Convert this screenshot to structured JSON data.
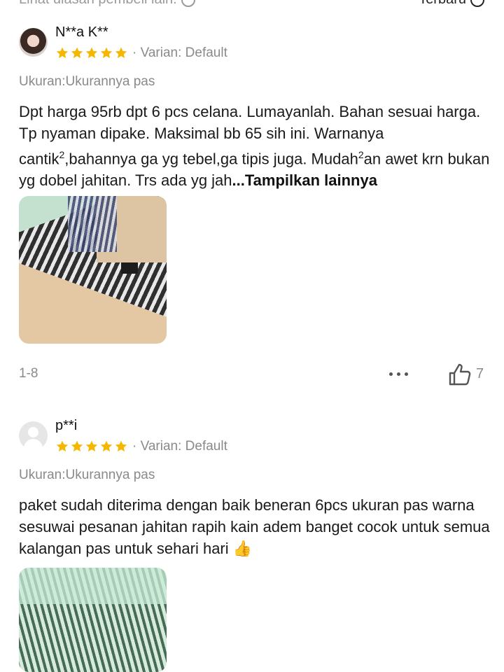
{
  "top": {
    "left_text": "Lihat ulasan pembeli lain.",
    "sort_label": "Terbaru"
  },
  "reviews": [
    {
      "username": "N**a K**",
      "rating": 5,
      "variant": "· Varian: Default",
      "size": "Ukuran:Ukurannya pas",
      "text_parts": [
        "Dpt harga 95rb dpt 6 pcs celana. Lumayanlah. Bahan sesuai harga. Tp nyaman dipake. Maksimal bb 65 sih ini. Warnanya cantik",
        "2",
        ",bahannya ga yg tebel,ga tipis juga. Mudah",
        "2",
        "an awet krn bukan yg dobel jahitan. Trs ada yg jah"
      ],
      "more_label": "...Tampilkan lainnya",
      "page_range": "1-8",
      "like_count": "7"
    },
    {
      "username": "p**i",
      "rating": 5,
      "variant": "· Varian: Default",
      "size": "Ukuran:Ukurannya pas",
      "text": "paket sudah diterima dengan baik beneran 6pcs ukuran pas warna sesuwai pesanan jahitan rapih kain adem banget cocok untuk semua kalangan pas untuk sehari hari 👍"
    }
  ],
  "colors": {
    "star": "#f5b700",
    "muted": "#8a8a8a",
    "text": "#1a1a1a"
  },
  "icons": {
    "star": "star-icon",
    "like": "thumbs-up-icon",
    "more": "more-dots-icon",
    "sort": "sort-icon",
    "info": "info-icon"
  }
}
